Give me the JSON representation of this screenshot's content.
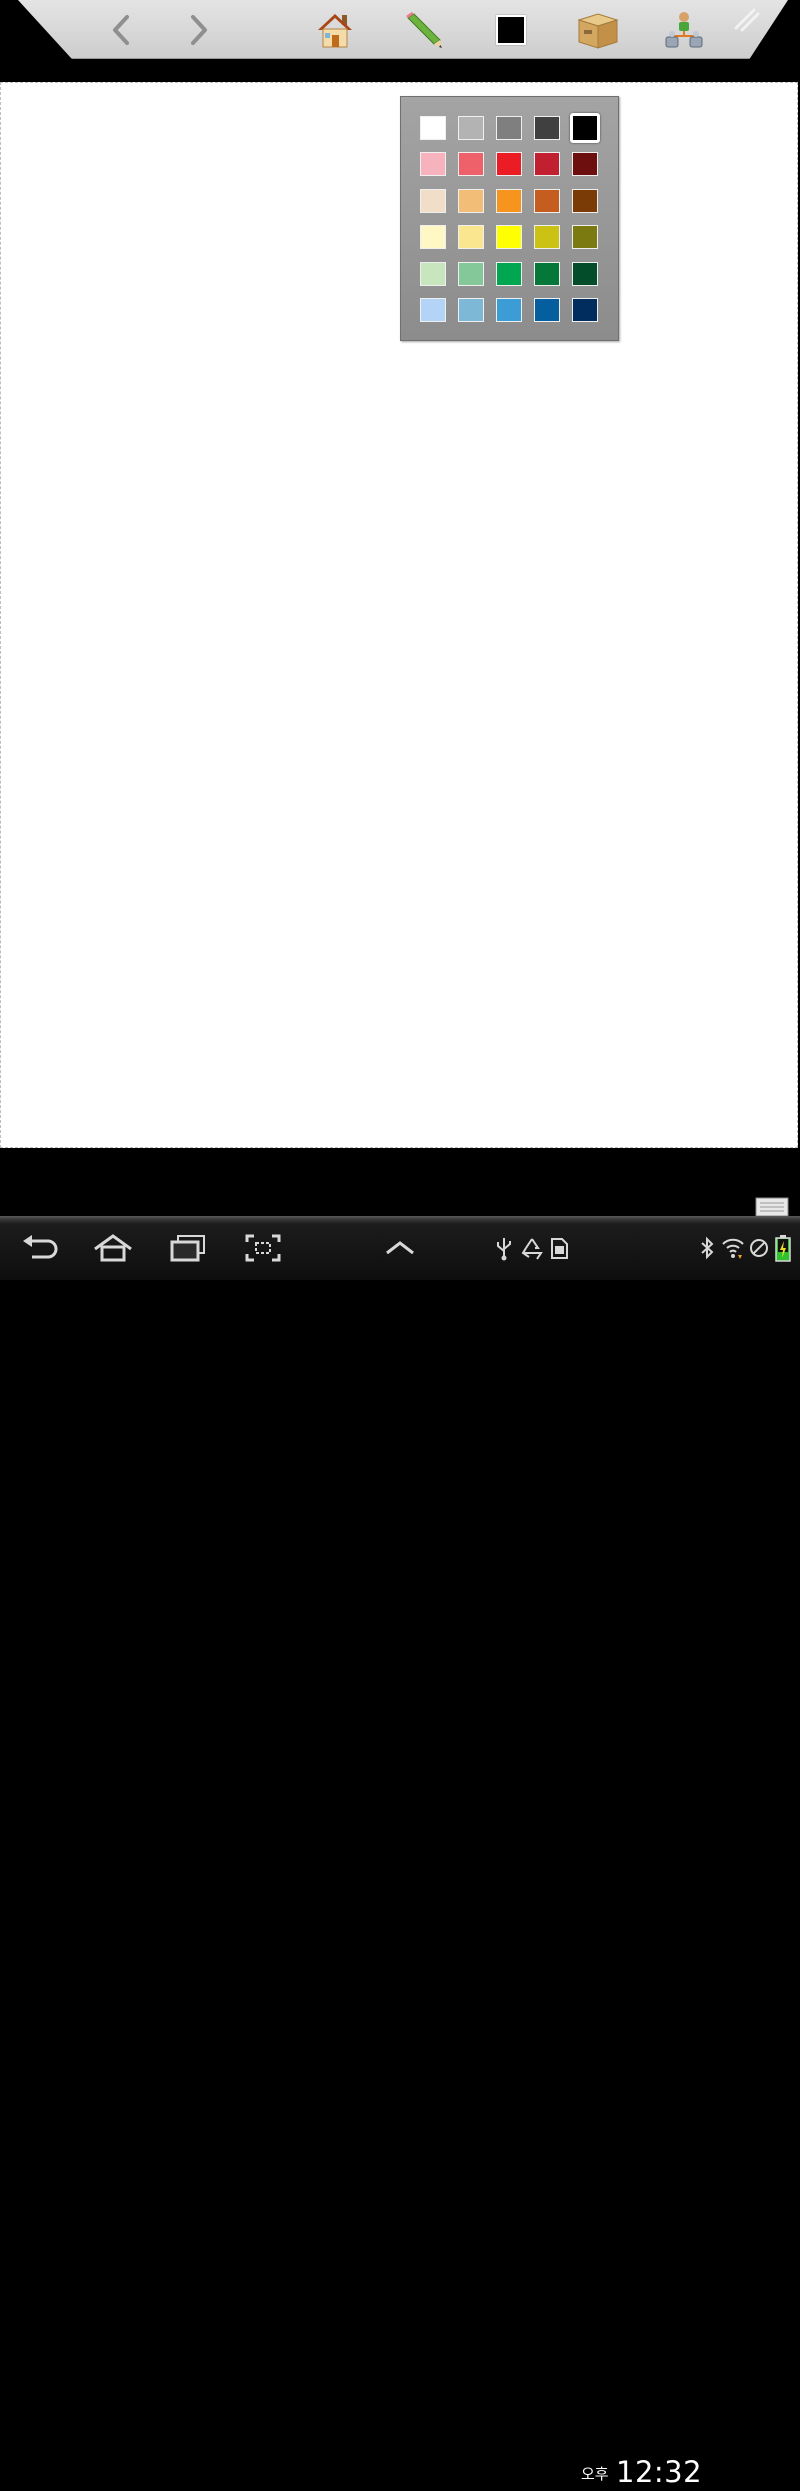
{
  "toolbar": {
    "buttons": [
      {
        "name": "back-button",
        "icon": "chevron-left-icon"
      },
      {
        "name": "forward-button",
        "icon": "chevron-right-icon"
      },
      {
        "name": "home-button",
        "icon": "home-icon"
      },
      {
        "name": "pencil-button",
        "icon": "pencil-icon"
      },
      {
        "name": "color-button",
        "icon": "color-square-icon",
        "current_color": "#000000"
      },
      {
        "name": "box-button",
        "icon": "box-icon"
      },
      {
        "name": "share-button",
        "icon": "network-icon"
      },
      {
        "name": "resize-grip",
        "icon": "grip-icon"
      }
    ]
  },
  "palette": {
    "selected": "#000000",
    "rows": [
      [
        "#ffffff",
        "#b3b3b3",
        "#7f7f7f",
        "#404040",
        "#000000"
      ],
      [
        "#f7b3bd",
        "#ee606a",
        "#ec1c24",
        "#c0202f",
        "#6e0f0f"
      ],
      [
        "#f0dec8",
        "#f2bd76",
        "#f7941d",
        "#c45d1e",
        "#7a3b07"
      ],
      [
        "#fff8c5",
        "#fbe690",
        "#ffff00",
        "#ccc214",
        "#7a7a10"
      ],
      [
        "#c7e6bd",
        "#84c89a",
        "#00a650",
        "#047739",
        "#044d2a"
      ],
      [
        "#b4d4f7",
        "#7db8d6",
        "#3c9cd6",
        "#055f9e",
        "#002c5e"
      ]
    ]
  },
  "system_bar": {
    "nav_icons": [
      "back-icon",
      "home-icon",
      "recent-apps-icon",
      "screenshot-icon",
      "chevron-up-icon"
    ],
    "status_icons": [
      "usb-icon",
      "recycle-icon",
      "sd-card-icon",
      "bluetooth-icon",
      "wifi-icon",
      "no-signal-icon",
      "battery-icon"
    ],
    "ampm": "오후",
    "time": "12:32"
  }
}
